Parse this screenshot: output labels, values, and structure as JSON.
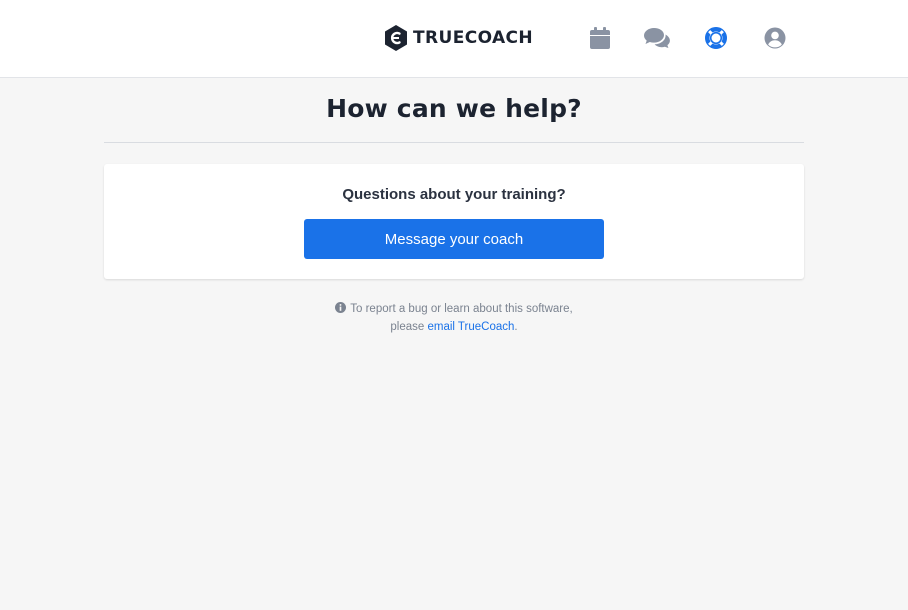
{
  "header": {
    "logo_text": "TRUECOACH",
    "nav": [
      {
        "icon": "calendar-icon"
      },
      {
        "icon": "chat-bubbles-icon"
      },
      {
        "icon": "lifebuoy-icon",
        "active": true
      },
      {
        "icon": "user-circle-icon"
      }
    ]
  },
  "main": {
    "title": "How can we help?",
    "card": {
      "question": "Questions about your training?",
      "button_label": "Message your coach"
    },
    "footnote": {
      "line1": "To report a bug or learn about this software,",
      "line2_prefix": "please",
      "link_text": "email TrueCoach",
      "line2_suffix": "."
    }
  },
  "colors": {
    "accent": "#1a72e8",
    "icon_inactive": "#8a93a3",
    "text_dark": "#1c2330",
    "background": "#f6f6f6"
  }
}
